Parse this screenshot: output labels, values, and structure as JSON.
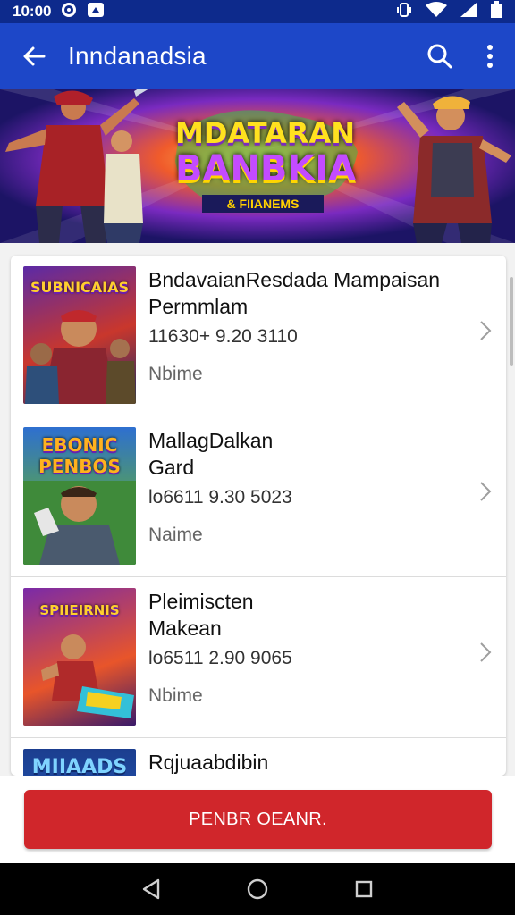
{
  "status": {
    "time": "10:00"
  },
  "app_bar": {
    "title": "Inndanadsia"
  },
  "banner": {
    "line1": "MDATARAN",
    "line2": "BANBKIA",
    "line3": "& FIIANEMS"
  },
  "items": [
    {
      "thumb_text": "SUBNICAIAS",
      "title_line1": "BndavaianResdada Mampaisan",
      "title_line2": "Permmlam",
      "meta": "11630+ 9.20 3110",
      "sub": "Nbime"
    },
    {
      "thumb_text": "EBONIC PENBOS",
      "title_line1": "MallagDalkan",
      "title_line2": "Gard",
      "meta": "lo6611 9.30 5023",
      "sub": "Naime"
    },
    {
      "thumb_text": "SPIIEIRNIS",
      "title_line1": "Pleimiscten",
      "title_line2": "Makean",
      "meta": "lo6511 2.90 9065",
      "sub": "Nbime"
    },
    {
      "thumb_text": "MIIAADS",
      "title_line1": "Rqjuaabdibin",
      "title_line2": "",
      "meta": "",
      "sub": ""
    }
  ],
  "cta": {
    "label": "PENBR OEANR."
  },
  "colors": {
    "primary": "#1d47c8",
    "status": "#0d2a8c",
    "cta": "#d0262b"
  }
}
